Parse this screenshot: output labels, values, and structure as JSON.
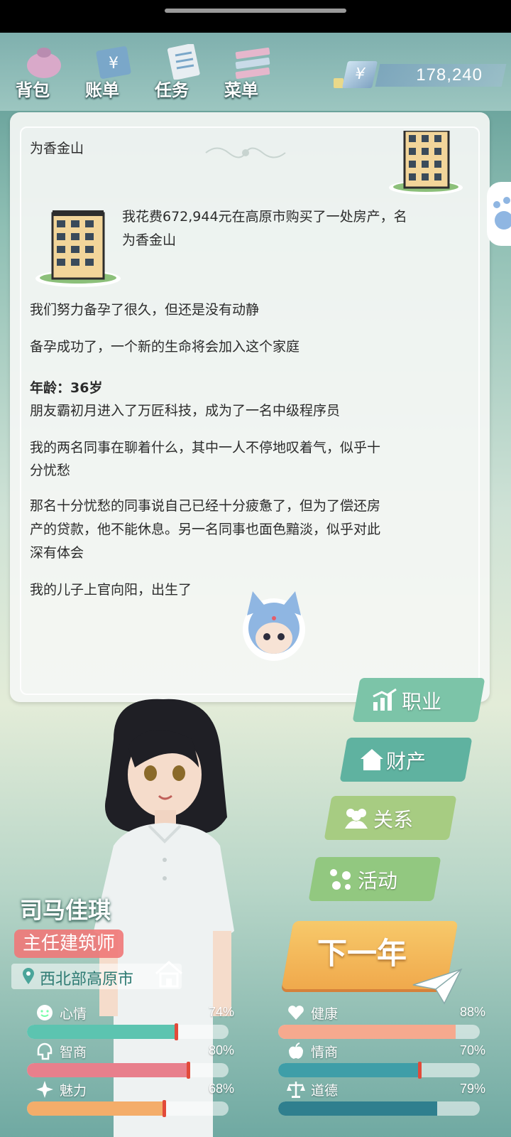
{
  "topbar": {
    "buttons": [
      {
        "label": "背包",
        "icon": "bag-icon"
      },
      {
        "label": "账单",
        "icon": "bill-icon"
      },
      {
        "label": "任务",
        "icon": "task-icon"
      },
      {
        "label": "菜单",
        "icon": "menu-icon"
      }
    ],
    "money_symbol": "¥",
    "money": "178,240"
  },
  "log": {
    "entries": [
      {
        "text": "为香金山",
        "bold": false
      },
      {
        "text": "我花费672,944元在高原市购买了一处房产，名",
        "bold": false
      },
      {
        "text": "为香金山",
        "bold": false
      },
      {
        "text": "我们努力备孕了很久，但还是没有动静",
        "bold": false
      },
      {
        "text": "备孕成功了，一个新的生命将会加入这个家庭",
        "bold": false
      },
      {
        "text": "年龄：36岁",
        "bold": true
      },
      {
        "text": "朋友霸初月进入了万匠科技，成为了一名中级程序员",
        "bold": false
      },
      {
        "text": "我的两名同事在聊着什么，其中一人不停地叹着气，似乎十",
        "bold": false
      },
      {
        "text": "分忧愁",
        "bold": false
      },
      {
        "text": "那名十分忧愁的同事说自己已经十分疲惫了，但为了偿还房",
        "bold": false
      },
      {
        "text": "产的贷款，他不能休息。另一名同事也面色黯淡，似乎对此",
        "bold": false
      },
      {
        "text": "深有体会",
        "bold": false
      },
      {
        "text": "我的儿子上官向阳，出生了",
        "bold": false
      }
    ]
  },
  "side_menu": [
    {
      "label": "职业",
      "icon": "career-chart-icon",
      "color": "#7cc4a8"
    },
    {
      "label": "财产",
      "icon": "house-icon",
      "color": "#5fb2a0"
    },
    {
      "label": "关系",
      "icon": "people-icon",
      "color": "#a7cc82"
    },
    {
      "label": "活动",
      "icon": "activity-icon",
      "color": "#92c880"
    }
  ],
  "next_year_label": "下一年",
  "character": {
    "name": "司马佳琪",
    "job": "主任建筑师",
    "location": "西北部高原市"
  },
  "stats": {
    "left": [
      {
        "name": "心情",
        "percent": "74%",
        "value": 74,
        "color": "#5cc4b0",
        "icon": "smile-icon"
      },
      {
        "name": "智商",
        "percent": "80%",
        "value": 80,
        "color": "#e87f8c",
        "icon": "brain-icon"
      },
      {
        "name": "魅力",
        "percent": "68%",
        "value": 68,
        "color": "#f4ad6a",
        "icon": "sparkle-icon"
      }
    ],
    "right": [
      {
        "name": "健康",
        "percent": "88%",
        "value": 88,
        "color": "#f6a98e",
        "icon": "heart-icon"
      },
      {
        "name": "情商",
        "percent": "70%",
        "value": 70,
        "color": "#3e9ea8",
        "icon": "apple-icon"
      },
      {
        "name": "道德",
        "percent": "79%",
        "value": 79,
        "color": "#2f7f8e",
        "icon": "scales-icon"
      }
    ]
  }
}
